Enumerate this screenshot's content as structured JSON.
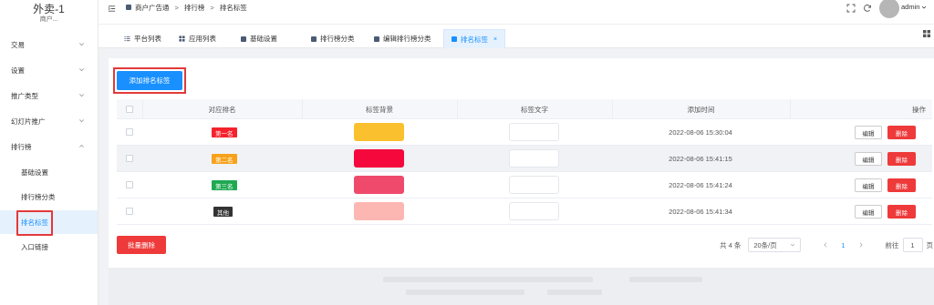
{
  "sidebar": {
    "brand_title": "外卖-1",
    "brand_sub": "商户...",
    "menu": [
      {
        "label": "交易"
      },
      {
        "label": "设置"
      },
      {
        "label": "推广类型"
      },
      {
        "label": "幻灯片推广"
      },
      {
        "label": "排行榜"
      }
    ],
    "submenu": [
      {
        "label": "基础设置"
      },
      {
        "label": "排行榜分类"
      },
      {
        "label": "排名标签"
      },
      {
        "label": "入口链接"
      }
    ]
  },
  "header": {
    "breadcrumb": [
      "商户广告通",
      "排行榜",
      "排名标签"
    ],
    "user": "admin"
  },
  "tabs": [
    {
      "label": "平台列表"
    },
    {
      "label": "应用列表"
    },
    {
      "label": "基础设置"
    },
    {
      "label": "排行榜分类"
    },
    {
      "label": "编辑排行榜分类"
    },
    {
      "label": "排名标签",
      "close": "×"
    }
  ],
  "content": {
    "add_label": "添加排名标签",
    "columns": [
      "对应排名",
      "标签背景",
      "标签文字",
      "添加时间",
      "操作"
    ],
    "rows": [
      {
        "rank": "第一名",
        "badge_color": "#f5222d",
        "bg_color": "#fbc02d",
        "time": "2022-08-06 15:30:04",
        "edit": "编辑",
        "delete": "删除"
      },
      {
        "rank": "第二名",
        "badge_color": "#f7a21b",
        "bg_color": "#f5083c",
        "time": "2022-08-06 15:41:15",
        "edit": "编辑",
        "delete": "删除"
      },
      {
        "rank": "第三名",
        "badge_color": "#1ea952",
        "bg_color": "#ef4a6c",
        "time": "2022-08-06 15:41:24",
        "edit": "编辑",
        "delete": "删除"
      },
      {
        "rank": "其他",
        "badge_color": "#333333",
        "bg_color": "#fdb7b2",
        "time": "2022-08-06 15:41:34",
        "edit": "编辑",
        "delete": "删除"
      }
    ],
    "batch_delete": "批量删除",
    "pagination": {
      "total": "共 4 条",
      "page_size": "20条/页",
      "current_page": "1",
      "goto_label": "前往",
      "goto_value": "1",
      "page_unit": "页"
    }
  }
}
